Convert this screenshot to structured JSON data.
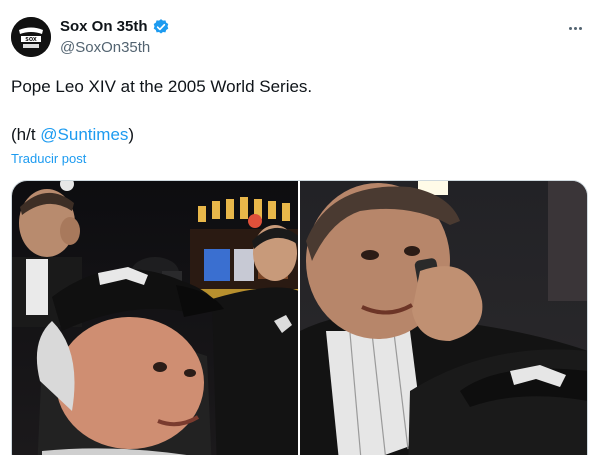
{
  "tweet": {
    "display_name": "Sox On 35th",
    "handle": "@SoxOn35th",
    "text": "Pope Leo XIV at the 2005 World Series.",
    "hat_tip_open": "(h/t ",
    "mention": "@Suntimes",
    "hat_tip_close": ")",
    "translate_label": "Traducir post"
  },
  "icons": {
    "avatar": "sox-on-35th-logo",
    "verified": "verified-badge-icon",
    "more": "more-options-icon"
  },
  "colors": {
    "accent": "#1d9bf0",
    "text": "#0f1419",
    "secondary": "#536471"
  },
  "media": {
    "photos": [
      {
        "name": "photo-fans-in-stadium"
      },
      {
        "name": "photo-man-on-phone"
      }
    ]
  }
}
